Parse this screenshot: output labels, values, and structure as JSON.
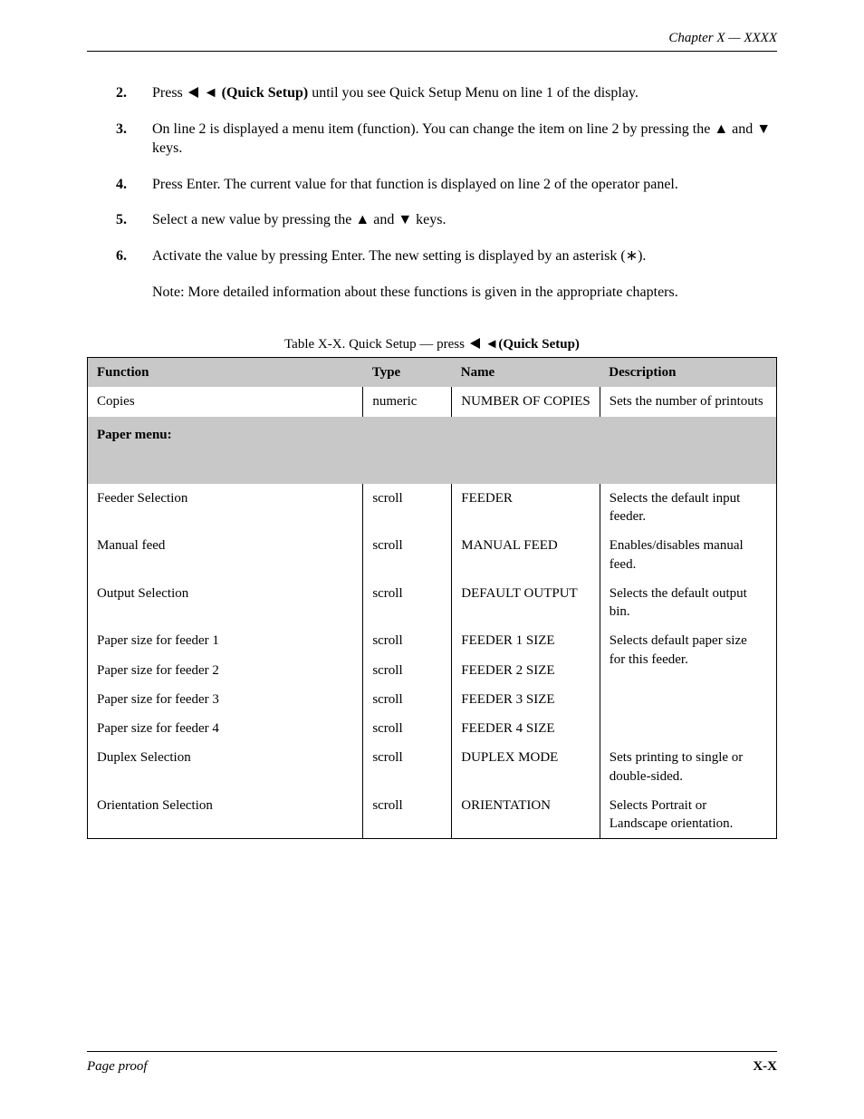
{
  "header": {
    "running": "Chapter X — XXXX"
  },
  "steps": {
    "s2": {
      "n": "2.",
      "text_before": "Press ",
      "key": "◄ (Quick Setup)",
      "text_after": " until you see Quick Setup Menu on line 1 of the display."
    },
    "s3": {
      "n": "3.",
      "text": "On line 2 is displayed a menu item (function). You can change the item on line 2 by pressing the ▲ and ▼ keys."
    },
    "s4": {
      "n": "4.",
      "text": "Press Enter. The current value for that function is displayed on line 2 of the operator panel."
    },
    "s5": {
      "n": "5.",
      "text": "Select a new value by pressing the ▲ and ▼ keys."
    },
    "s6": {
      "n": "6.",
      "text": "Activate the value by pressing Enter. The new setting is displayed by an asterisk (∗)."
    }
  },
  "note": "Note: More detailed information about these functions is given in the appropriate chapters.",
  "table": {
    "caption_prefix": "Table X-X. Quick Setup — press ",
    "caption_key": "◄(Quick Setup)",
    "headers": [
      "Function",
      "Type",
      "Name",
      "Description"
    ],
    "row1": [
      "Copies",
      "numeric",
      "NUMBER OF COPIES",
      "Sets the number of printouts"
    ],
    "subhead": "Paper menu:",
    "rows": [
      [
        "Feeder Selection",
        "scroll",
        "FEEDER",
        "Selects the default input feeder."
      ],
      [
        "Manual feed",
        "scroll",
        "MANUAL FEED",
        "Enables/disables manual feed."
      ],
      [
        "Output Selection",
        "scroll",
        "DEFAULT OUTPUT",
        "Selects the default output bin."
      ],
      [
        "Paper size for feeder 1",
        "scroll",
        "FEEDER 1 SIZE",
        ""
      ],
      [
        "Paper size for feeder 2",
        "scroll",
        "FEEDER 2 SIZE",
        ""
      ],
      [
        "Paper size for feeder 3",
        "scroll",
        "FEEDER 3 SIZE",
        ""
      ],
      [
        "Paper size for feeder 4",
        "scroll",
        "FEEDER 4 SIZE",
        ""
      ],
      [
        "Duplex Selection",
        "scroll",
        "DUPLEX MODE",
        "Sets printing to single or double-sided."
      ],
      [
        "Orientation Selection",
        "scroll",
        "ORIENTATION",
        "Selects Portrait or Landscape orientation."
      ]
    ],
    "size_desc_line1": "Selects default paper size",
    "size_desc_line2": "for this feeder."
  },
  "footer": {
    "left": "Page proof",
    "right": "X-X"
  }
}
